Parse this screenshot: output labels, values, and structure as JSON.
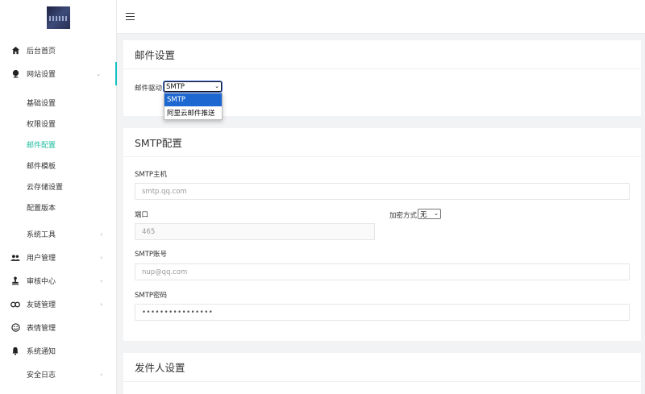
{
  "sidebar": {
    "items": [
      {
        "label": "后台首页",
        "icon": "home-icon",
        "chevron": ""
      },
      {
        "label": "网站设置",
        "icon": "globe-icon",
        "chevron": "⌄"
      }
    ],
    "sub_items": [
      "基础设置",
      "权限设置",
      "邮件配置",
      "邮件模板",
      "云存储设置",
      "配置版本"
    ],
    "items_after": [
      {
        "label": "系统工具",
        "icon": "",
        "chevron": "›"
      },
      {
        "label": "用户管理",
        "icon": "users-icon",
        "chevron": "›"
      },
      {
        "label": "审核中心",
        "icon": "stamp-icon",
        "chevron": "›"
      },
      {
        "label": "友链管理",
        "icon": "link-icon",
        "chevron": "›"
      },
      {
        "label": "表情管理",
        "icon": "smile-icon",
        "chevron": ""
      },
      {
        "label": "系统通知",
        "icon": "bell-icon",
        "chevron": ""
      },
      {
        "label": "安全日志",
        "icon": "",
        "chevron": "›"
      }
    ]
  },
  "mail_settings": {
    "title": "邮件设置",
    "driver_label": "邮件驱动",
    "driver_value": "SMTP",
    "driver_options": [
      "SMTP",
      "阿里云邮件推送"
    ]
  },
  "smtp_config": {
    "title": "SMTP配置",
    "host_label": "SMTP主机",
    "host_placeholder": "smtp.qq.com",
    "port_label": "端口",
    "port_placeholder": "465",
    "encryption_label": "加密方式",
    "encryption_value": "无",
    "account_label": "SMTP账号",
    "account_placeholder": "nup@qq.com",
    "password_label": "SMTP密码",
    "password_value": "••••••••••••••••"
  },
  "sender_settings": {
    "title": "发件人设置"
  },
  "colors": {
    "accent": "#1abc9c",
    "select_highlight": "#1d68d0"
  }
}
